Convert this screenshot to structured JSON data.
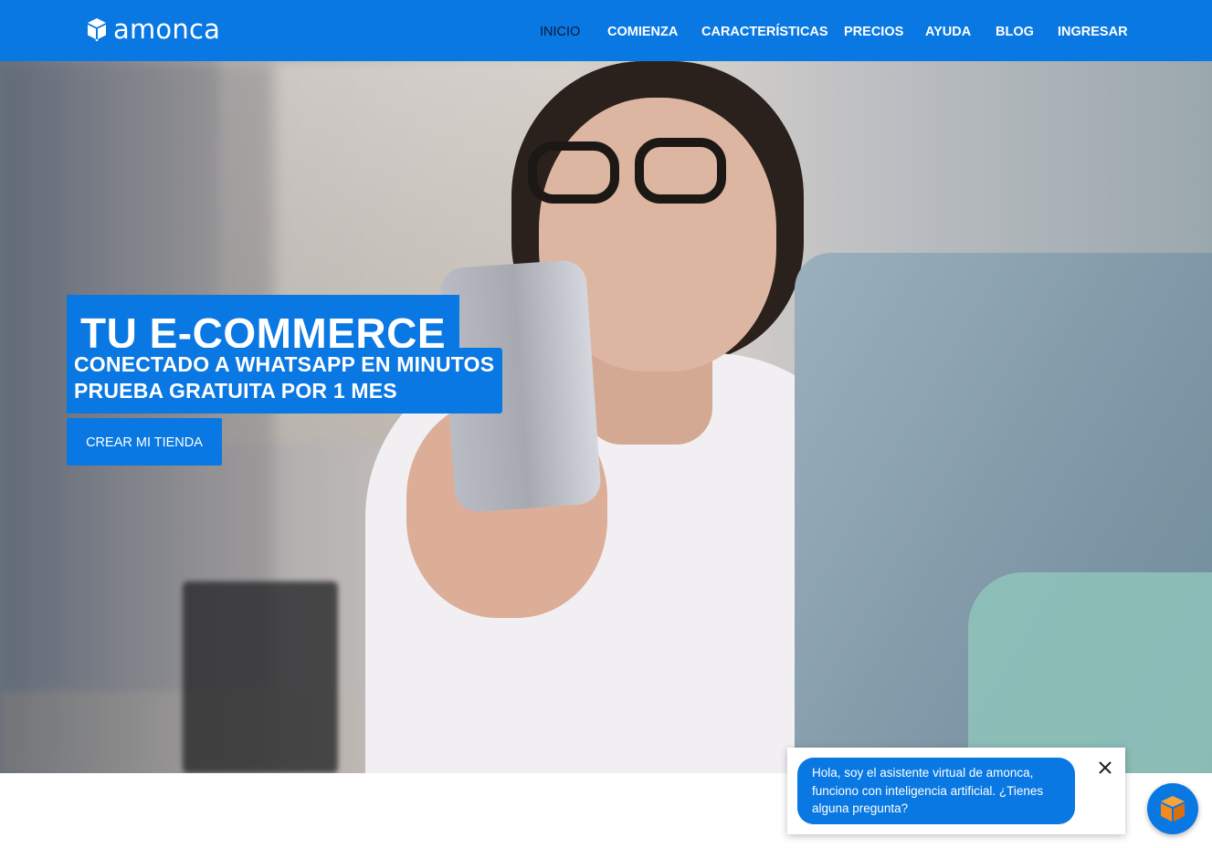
{
  "header": {
    "brand": "amonca",
    "nav": [
      {
        "label": "INICIO",
        "active": true
      },
      {
        "label": "COMIENZA"
      },
      {
        "label": "CARACTERÍSTICAS"
      },
      {
        "label": "PRECIOS"
      },
      {
        "label": "AYUDA"
      },
      {
        "label": "BLOG"
      },
      {
        "label": "INGRESAR"
      }
    ]
  },
  "hero": {
    "headline": "TU E-COMMERCE",
    "subline1": "CONECTADO A WHATSAPP EN MINUTOS",
    "subline2": "PRUEBA GRATUITA POR 1 MES",
    "cta_label": "CREAR MI TIENDA"
  },
  "chat": {
    "message": "Hola, soy el asistente virtual de amonca, funciono con inteligencia artificial. ¿Tienes alguna pregunta?",
    "close_icon": "close-icon",
    "launcher_icon": "cube-icon"
  },
  "colors": {
    "brand_blue": "#0a78e2",
    "active_nav": "#0b1833",
    "launcher_cube": "#f28a1e"
  }
}
